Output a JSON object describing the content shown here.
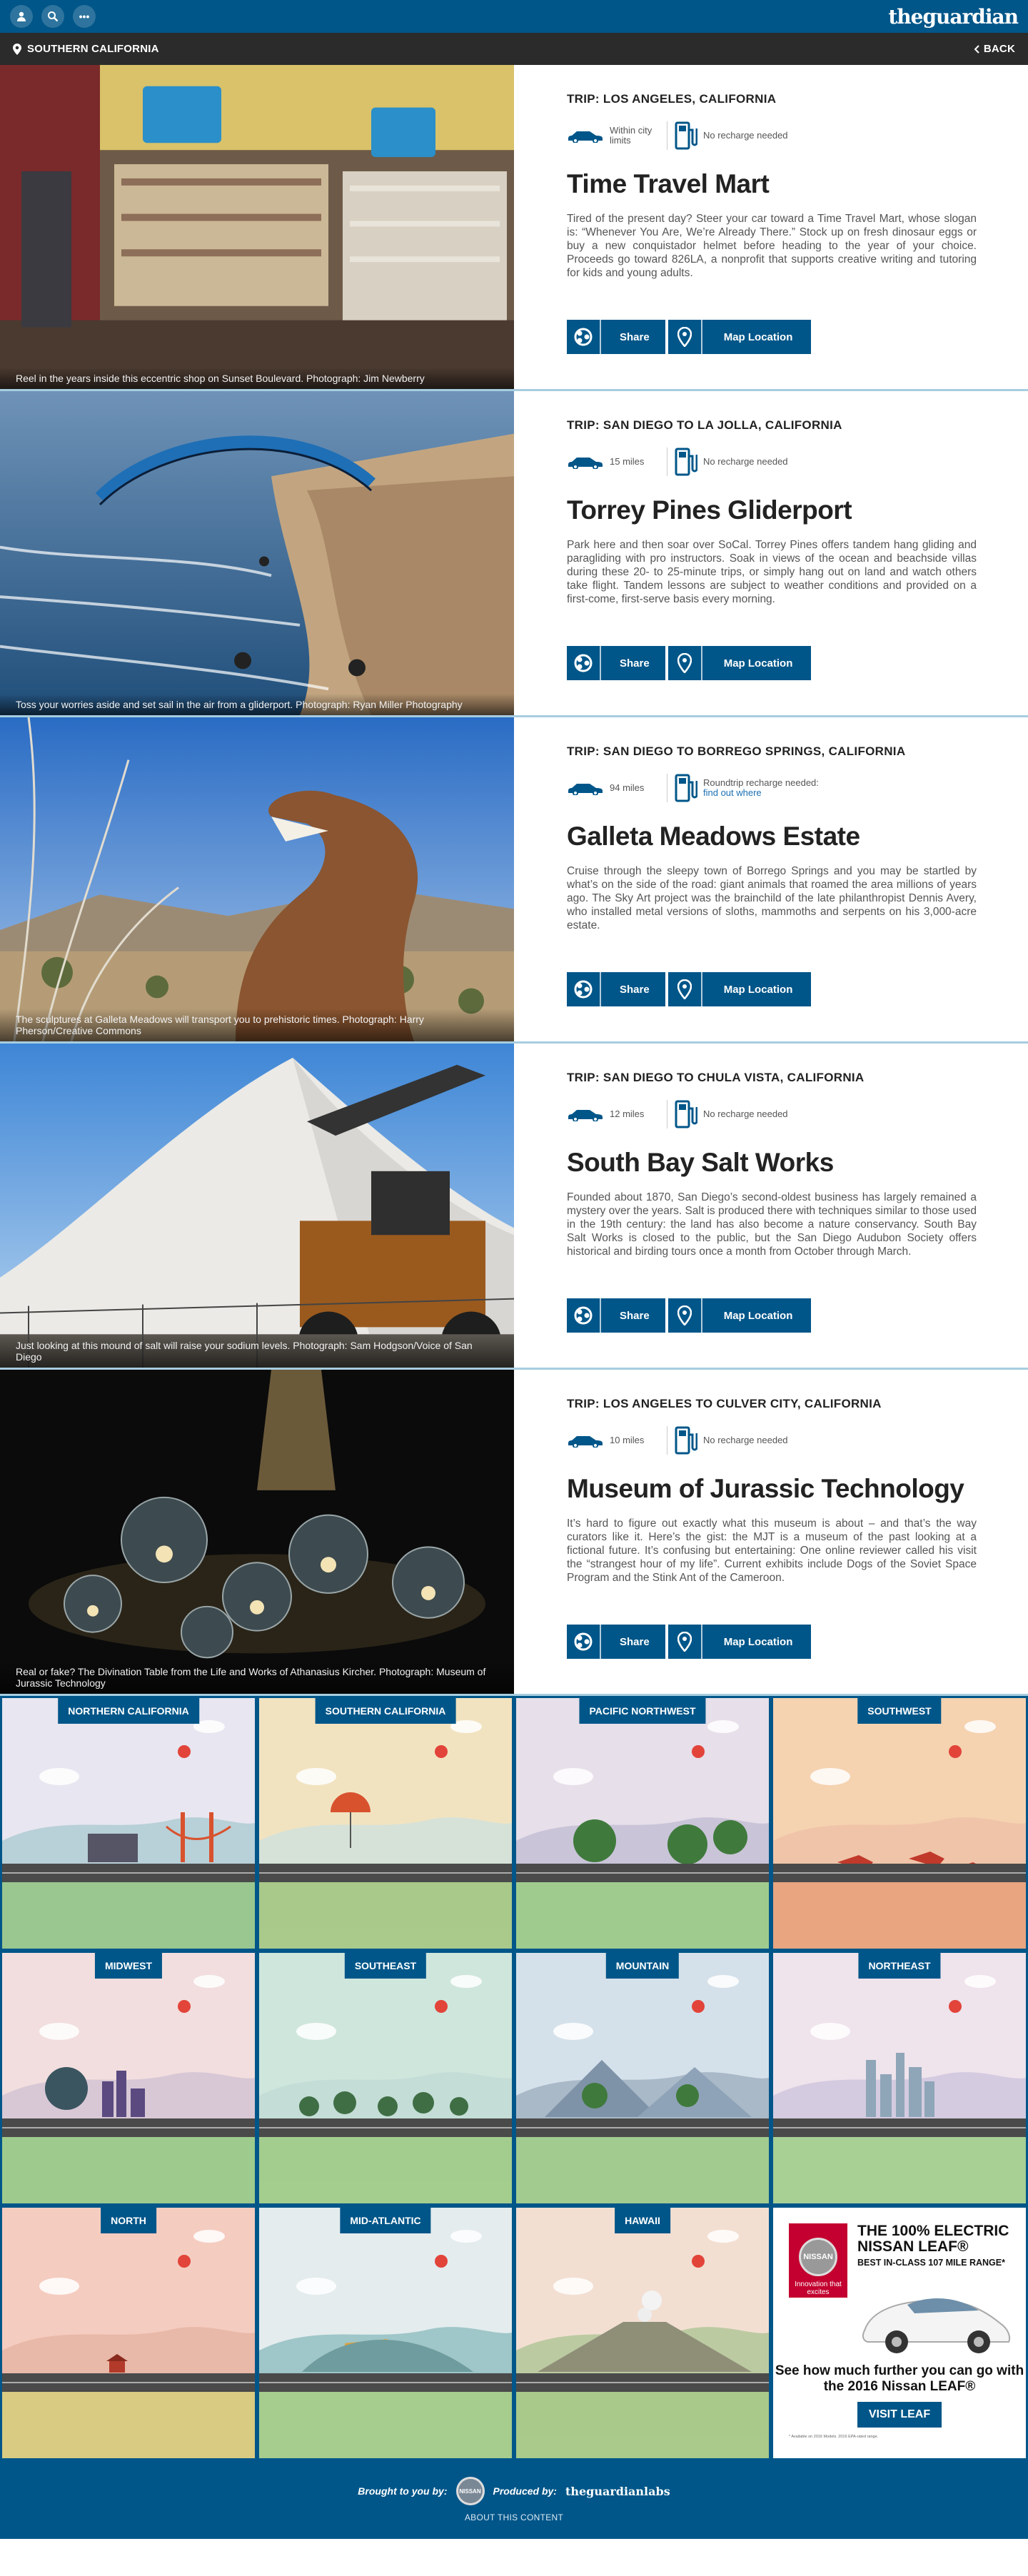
{
  "header": {
    "logo": "theguardian",
    "tools": {
      "profile": "profile-icon",
      "search": "search-icon",
      "more": "•••"
    }
  },
  "region_bar": {
    "region": "SOUTHERN CALIFORNIA",
    "back": "BACK"
  },
  "labels": {
    "share": "Share",
    "map": "Map Location",
    "no_recharge": "No recharge needed"
  },
  "trips": [
    {
      "trip": "TRIP: LOS ANGELES, CALIFORNIA",
      "distance": "Within city limits",
      "recharge": "No recharge needed",
      "title": "Time Travel Mart",
      "description": "Tired of the present day? Steer your car toward a Time Travel Mart, whose slogan is: “Whenever You Are, We’re Already There.” Stock up on fresh dinosaur eggs or buy a new conquistador helmet before heading to the year of your choice. Proceeds go toward 826LA, a nonprofit that supports creative writing and tutoring for kids and young adults.",
      "caption": "Reel in the years inside this eccentric shop on Sunset Boulevard. Photograph: Jim Newberry"
    },
    {
      "trip": "TRIP: SAN DIEGO TO LA JOLLA, CALIFORNIA",
      "distance": "15 miles",
      "recharge": "No recharge needed",
      "title": "Torrey Pines Gliderport",
      "description": "Park here and then soar over SoCal. Torrey Pines offers tandem hang gliding and paragliding with pro instructors. Soak in views of the ocean and beachside villas during these 20- to 25-minute trips, or simply hang out on land and watch others take flight. Tandem lessons are subject to weather conditions and provided on a first-come, first-serve basis every morning.",
      "caption": "Toss your worries aside and set sail in the air from a gliderport. Photograph: Ryan Miller Photography"
    },
    {
      "trip": "TRIP: SAN DIEGO TO BORREGO SPRINGS, CALIFORNIA",
      "distance": "94 miles",
      "recharge": "Roundtrip recharge needed:",
      "recharge_link": "find out where",
      "title": "Galleta Meadows Estate",
      "description": "Cruise through the sleepy town of Borrego Springs and you may be startled by what’s on the side of the road: giant animals that roamed the area millions of years ago. The Sky Art project was the brainchild of the late philanthropist Dennis Avery, who installed metal versions of sloths, mammoths and serpents on his 3,000-acre estate.",
      "caption": "The sculptures at Galleta Meadows will transport you to prehistoric times. Photograph: Harry Pherson/Creative Commons"
    },
    {
      "trip": "TRIP: SAN DIEGO TO CHULA VISTA, CALIFORNIA",
      "distance": "12 miles",
      "recharge": "No recharge needed",
      "title": "South Bay Salt Works",
      "description": "Founded about 1870, San Diego’s second-oldest business has largely remained a mystery over the years. Salt is produced there with techniques similar to those used in the 19th century: the land has also become a nature conservancy. South Bay Salt Works is closed to the public, but the San Diego Audubon Society offers historical and birding tours once a month from October through March.",
      "caption": "Just looking at this mound of salt will raise your sodium levels. Photograph: Sam Hodgson/Voice of San Diego"
    },
    {
      "trip": "TRIP: LOS ANGELES TO CULVER CITY, CALIFORNIA",
      "distance": "10 miles",
      "recharge": "No recharge needed",
      "title": "Museum of Jurassic Technology",
      "description": "It’s hard to figure out exactly what this museum is about – and that’s the way curators like it. Here’s the gist: the MJT is a museum of the past looking at a fictional future. It’s confusing but entertaining: One online reviewer called his visit the “strangest hour of my life”. Current exhibits include Dogs of the Soviet Space Program and the Stink Ant of the Cameroon.",
      "caption": "Real or fake? The Divination Table from the Life and Works of Athanasius Kircher. Photograph: Museum of Jurassic Technology"
    }
  ],
  "regions": [
    {
      "name": "NORTHERN CALIFORNIA",
      "sky": "#e8e6f0",
      "ground": "#9ac78f",
      "hill": "#b8d0d8"
    },
    {
      "name": "SOUTHERN CALIFORNIA",
      "sky": "#f2e3c0",
      "ground": "#a9c98a",
      "hill": "#d6e2d8"
    },
    {
      "name": "PACIFIC NORTHWEST",
      "sky": "#e7dfe9",
      "ground": "#9fcc8e",
      "hill": "#c9c4d8"
    },
    {
      "name": "SOUTHWEST",
      "sky": "#f5d2b0",
      "ground": "#e8a580",
      "hill": "#f0c4a8"
    },
    {
      "name": "MIDWEST",
      "sky": "#f2dede",
      "ground": "#9ecb8d",
      "hill": "#d8c8d6"
    },
    {
      "name": "SOUTHEAST",
      "sky": "#cfe6dd",
      "ground": "#a3cd8e",
      "hill": "#c4ddd6"
    },
    {
      "name": "MOUNTAIN",
      "sky": "#d5e1ea",
      "ground": "#a2cb8f",
      "hill": "#a9b9c8"
    },
    {
      "name": "NORTHEAST",
      "sky": "#efe3ec",
      "ground": "#a8cf94",
      "hill": "#d4cbe0"
    },
    {
      "name": "NORTH",
      "sky": "#f5ccc0",
      "ground": "#d9cb82",
      "hill": "#e8b8a8"
    },
    {
      "name": "MID-ATLANTIC",
      "sky": "#e4ecee",
      "ground": "#a6cc8e",
      "hill": "#9fc6c8"
    },
    {
      "name": "HAWAII",
      "sky": "#f3dfd2",
      "ground": "#a9c98a",
      "hill": "#bccaa2"
    }
  ],
  "ad": {
    "brand": "NISSAN",
    "brand_sub": "Innovation that excites",
    "headline": "THE 100% ELECTRIC NISSAN LEAF®",
    "subhead": "BEST IN-CLASS 107 MILE RANGE*",
    "cta": "See how much further you can go with the 2016 Nissan LEAF®",
    "button": "VISIT LEAF",
    "fine_print": "* Available on 2016 Models. 2016 EPA-rated range."
  },
  "footer": {
    "brought": "Brought to you by:",
    "produced": "Produced by:",
    "labs": "theguardianlabs",
    "about": "ABOUT THIS CONTENT"
  },
  "colors": {
    "guardian_blue": "#005689",
    "dark_bar": "#2b2b2b",
    "link": "#1a6fb3"
  }
}
